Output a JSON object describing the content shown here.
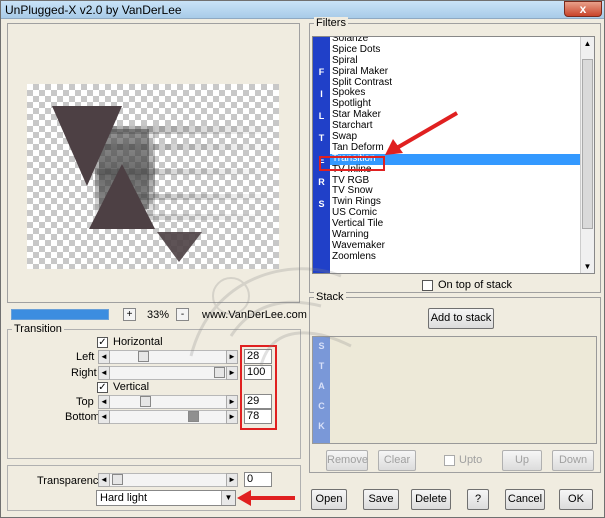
{
  "window": {
    "title": "UnPlugged-X v2.0 by VanDerLee",
    "close_glyph": "x"
  },
  "preview": {
    "zoom_plus": "+",
    "zoom_minus": "-",
    "zoom_value": "33%",
    "website": "www.VanDerLee.com",
    "progress_fraction": 1.0
  },
  "transition": {
    "group_label": "Transition",
    "horizontal_label": "Horizontal",
    "horizontal_checked_glyph": "✓",
    "left_label": "Left",
    "left_value": "28",
    "right_label": "Right",
    "right_value": "100",
    "vertical_label": "Vertical",
    "vertical_checked_glyph": "✓",
    "top_label": "Top",
    "top_value": "29",
    "bottom_label": "Bottom",
    "bottom_value": "78",
    "transparency_label": "Transparency",
    "transparency_value": "0",
    "blend_mode": "Hard light"
  },
  "filters": {
    "group_label": "Filters",
    "strip_text": "F I L T E R S",
    "items": [
      "Solarize",
      "Spice Dots",
      "Spiral",
      "Spiral Maker",
      "Split Contrast",
      "Spokes",
      "Spotlight",
      "Star Maker",
      "Starchart",
      "Swap",
      "Tan Deform",
      "Transition",
      "TV Inline",
      "TV RGB",
      "TV Snow",
      "Twin Rings",
      "US Comic",
      "Vertical Tile",
      "Warning",
      "Wavemaker",
      "Zoomlens"
    ],
    "selected": "Transition",
    "on_top_label": "On top of stack"
  },
  "stack": {
    "group_label": "Stack",
    "add_label": "Add to stack",
    "strip_text": "S T A C K",
    "remove_label": "Remove",
    "clear_label": "Clear",
    "upto_label": "Upto",
    "up_label": "Up",
    "down_label": "Down"
  },
  "buttons": {
    "open": "Open",
    "save": "Save",
    "delete": "Delete",
    "help": "?",
    "cancel": "Cancel",
    "ok": "OK"
  },
  "colors": {
    "accent_red": "#e02020",
    "selection_blue": "#3399ff",
    "strip_blue": "#2040c8"
  }
}
